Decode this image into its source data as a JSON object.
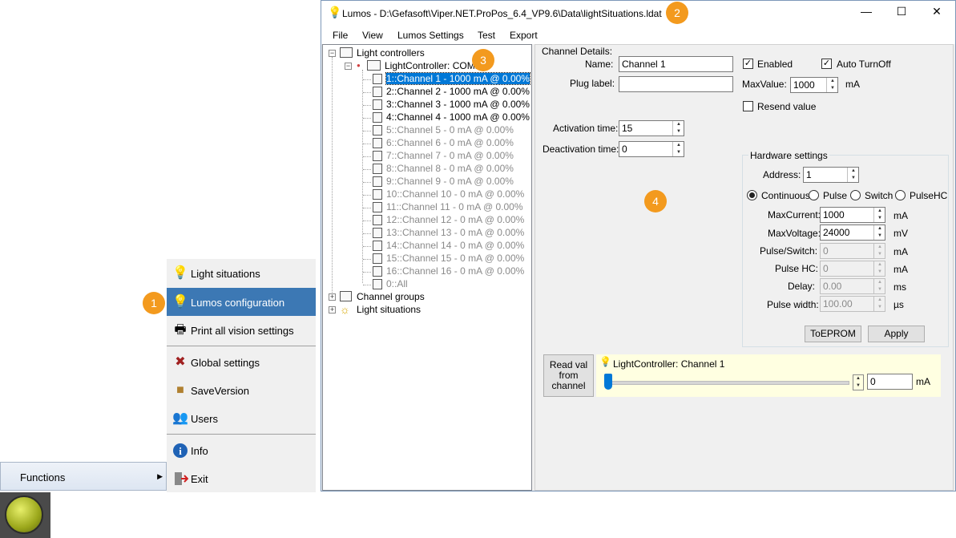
{
  "window": {
    "title": "Lumos - D:\\Gefasoft\\Viper.NET.ProPos_6.4_VP9.6\\Data\\lightSituations.ldat",
    "minimize": "—",
    "maximize": "☐",
    "close": "✕"
  },
  "menubar": [
    "File",
    "View",
    "Lumos Settings",
    "Test",
    "Export"
  ],
  "tree": {
    "root": "Light controllers",
    "controller": "LightController: COM1",
    "channels": [
      "1::Channel 1 - 1000 mA @ 0.00%",
      "2::Channel 2 - 1000 mA @ 0.00%",
      "3::Channel 3 - 1000 mA @ 0.00%",
      "4::Channel 4 - 1000 mA @ 0.00%",
      "5::Channel 5 - 0 mA @ 0.00%",
      "6::Channel 6 - 0 mA @ 0.00%",
      "7::Channel 7 - 0 mA @ 0.00%",
      "8::Channel 8 - 0 mA @ 0.00%",
      "9::Channel 9 - 0 mA @ 0.00%",
      "10::Channel 10 - 0 mA @ 0.00%",
      "11::Channel 11 - 0 mA @ 0.00%",
      "12::Channel 12 - 0 mA @ 0.00%",
      "13::Channel 13 - 0 mA @ 0.00%",
      "14::Channel 14 - 0 mA @ 0.00%",
      "15::Channel 15 - 0 mA @ 0.00%",
      "16::Channel 16 - 0 mA @ 0.00%",
      "0::All"
    ],
    "channel_groups": "Channel groups",
    "light_situations": "Light situations"
  },
  "details": {
    "group_title": "Channel Details:",
    "name_label": "Name:",
    "name_value": "Channel 1",
    "plug_label": "Plug label:",
    "plug_value": "",
    "enabled_label": "Enabled",
    "auto_turnoff_label": "Auto TurnOff",
    "maxvalue_label": "MaxValue:",
    "maxvalue_value": "1000",
    "maxvalue_unit": "mA",
    "resend_label": "Resend value",
    "activation_label": "Activation time:",
    "activation_value": "15",
    "deactivation_label": "Deactivation time:",
    "deactivation_value": "0"
  },
  "hardware": {
    "title": "Hardware settings",
    "address_label": "Address:",
    "address_value": "1",
    "modes": [
      "Continuous",
      "Pulse",
      "Switch",
      "PulseHC"
    ],
    "maxcurrent_label": "MaxCurrent:",
    "maxcurrent_value": "1000",
    "maxcurrent_unit": "mA",
    "maxvoltage_label": "MaxVoltage:",
    "maxvoltage_value": "24000",
    "maxvoltage_unit": "mV",
    "pulseswitch_label": "Pulse/Switch:",
    "pulseswitch_value": "0",
    "pulseswitch_unit": "mA",
    "pulsehc_label": "Pulse HC:",
    "pulsehc_value": "0",
    "pulsehc_unit": "mA",
    "delay_label": "Delay:",
    "delay_value": "0.00",
    "delay_unit": "ms",
    "pulsewidth_label": "Pulse width:",
    "pulsewidth_value": "100.00",
    "pulsewidth_unit": "µs",
    "toeprom_label": "ToEPROM",
    "apply_label": "Apply"
  },
  "readval": {
    "button_label_1": "Read val",
    "button_label_2": "from",
    "button_label_3": "channel",
    "channel_label": "LightController: Channel 1",
    "value": "0",
    "unit": "mA"
  },
  "start_menu": {
    "items": [
      "Light situations",
      "Lumos configuration",
      "Print all vision settings",
      "Global settings",
      "SaveVersion",
      "Users",
      "Info",
      "Exit"
    ],
    "functions_label": "Functions",
    "functions_arrow": "▶"
  },
  "callouts": [
    "1",
    "2",
    "3",
    "4"
  ],
  "colors": {
    "accent": "#f39a1e",
    "selection": "#3c78b4",
    "tree_selection": "#0078d7"
  }
}
